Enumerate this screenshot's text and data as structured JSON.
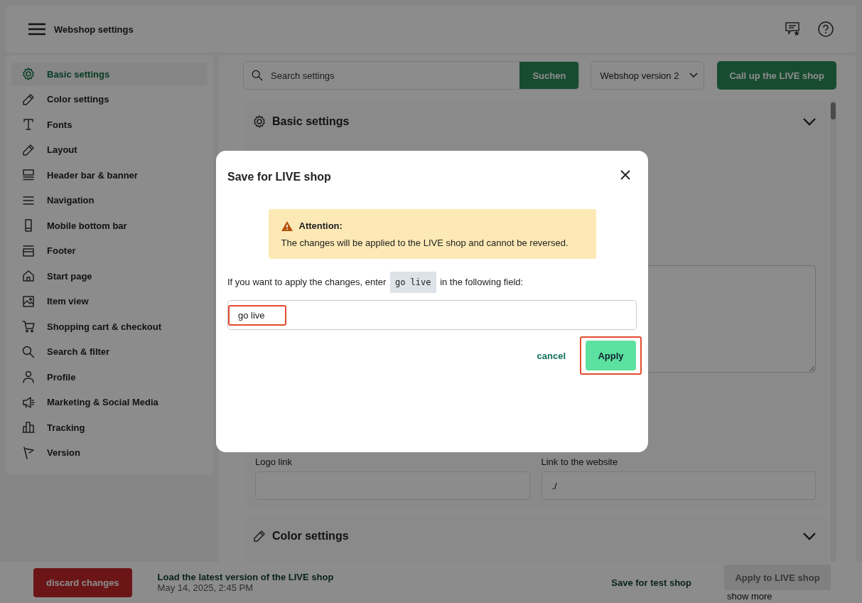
{
  "header": {
    "title": "Webshop settings"
  },
  "sidebar": {
    "items": [
      {
        "label": "Basic settings",
        "selected": true
      },
      {
        "label": "Color settings",
        "selected": false
      },
      {
        "label": "Fonts",
        "selected": false
      },
      {
        "label": "Layout",
        "selected": false
      },
      {
        "label": "Header bar & banner",
        "selected": false
      },
      {
        "label": "Navigation",
        "selected": false
      },
      {
        "label": "Mobile bottom bar",
        "selected": false
      },
      {
        "label": "Footer",
        "selected": false
      },
      {
        "label": "Start page",
        "selected": false
      },
      {
        "label": "Item view",
        "selected": false
      },
      {
        "label": "Shopping cart & checkout",
        "selected": false
      },
      {
        "label": "Search & filter",
        "selected": false
      },
      {
        "label": "Profile",
        "selected": false
      },
      {
        "label": "Marketing & Social Media",
        "selected": false
      },
      {
        "label": "Tracking",
        "selected": false
      },
      {
        "label": "Version",
        "selected": false
      }
    ]
  },
  "toolbar": {
    "search": {
      "placeholder": "Search settings"
    },
    "search_button": "Suchen",
    "version_select": "Webshop version 2",
    "live_button": "Call up the LIVE shop"
  },
  "sections": [
    {
      "title": "Basic settings",
      "expanded": true,
      "fields": [
        {
          "label": "Logo link"
        },
        {
          "label": "Link to the website",
          "value": "./"
        }
      ]
    },
    {
      "title": "Color settings",
      "expanded": false
    }
  ],
  "footer": {
    "discard_button": "discard changes",
    "load_link": "Load the latest version of the LIVE shop",
    "date": "May 14, 2025, 2:45 PM",
    "save_test_button": "Save for test shop",
    "apply_live_button": {
      "label": "Apply to LIVE shop",
      "disabled": true
    },
    "show_more": "show more"
  },
  "dialog": {
    "title": "Save for LIVE shop",
    "alert": {
      "heading": "Attention:",
      "message": "The changes will be applied to the LIVE shop and cannot be reversed."
    },
    "instruction": {
      "before": "If you want to apply the changes, enter ",
      "code": "go live",
      "after": " in the following field:"
    },
    "input": {
      "value": "go live",
      "highlighted": true
    },
    "cancel": "cancel",
    "apply": {
      "label": "Apply",
      "highlighted": true
    }
  }
}
